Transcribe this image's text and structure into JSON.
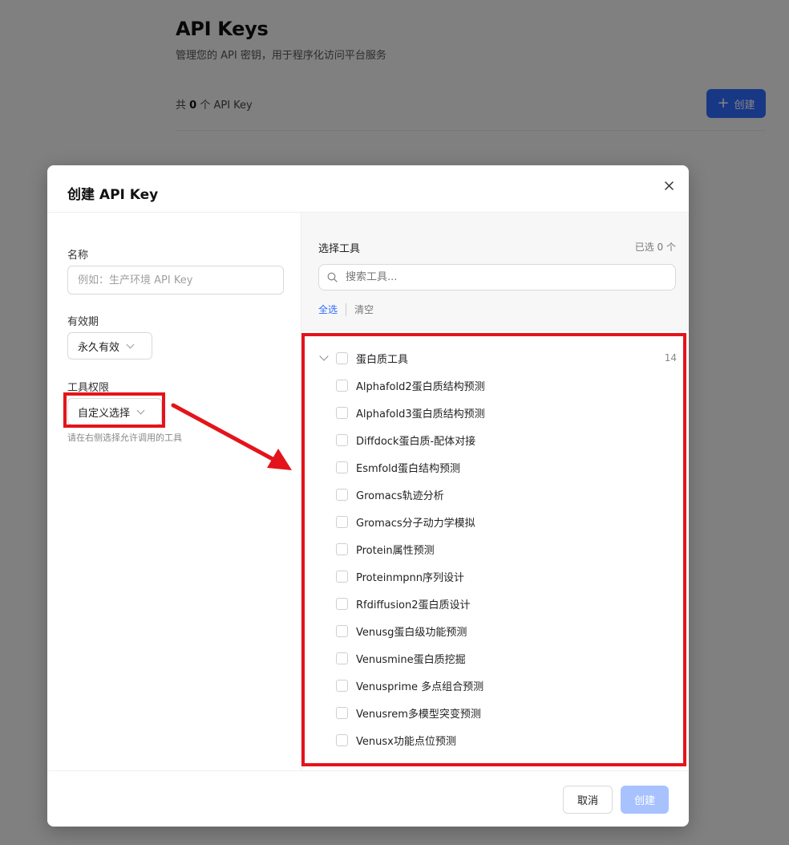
{
  "page": {
    "title": "API Keys",
    "subtitle": "管理您的 API 密钥，用于程序化访问平台服务",
    "count_prefix": "共",
    "count_value": "0",
    "count_suffix": "个 API Key",
    "create_label": "创建"
  },
  "modal": {
    "title": "创建 API Key",
    "close_icon": "close-icon",
    "name_label": "名称",
    "name_placeholder": "例如：生产环境 API Key",
    "name_value": "",
    "expiry_label": "有效期",
    "expiry_value": "永久有效",
    "permission_label": "工具权限",
    "permission_value": "自定义选择",
    "permission_hint": "请在右侧选择允许调用的工具",
    "tools_title": "选择工具",
    "selected_count": "已选 0 个",
    "search_placeholder": "搜索工具...",
    "select_all": "全选",
    "clear": "清空",
    "group": {
      "name": "蛋白质工具",
      "count": "14"
    },
    "tools": [
      "Alphafold2蛋白质结构预测",
      "Alphafold3蛋白质结构预测",
      "Diffdock蛋白质-配体对接",
      "Esmfold蛋白结构预测",
      "Gromacs轨迹分析",
      "Gromacs分子动力学模拟",
      "Protein属性预测",
      "Proteinmpnn序列设计",
      "Rfdiffusion2蛋白质设计",
      "Venusg蛋白级功能预测",
      "Venusmine蛋白质挖掘",
      "Venusprime 多点组合预测",
      "Venusrem多模型突变预测",
      "Venusx功能点位预测"
    ],
    "cancel_label": "取消",
    "create_label": "创建"
  },
  "colors": {
    "accent": "#2f6bff",
    "disabled_accent": "#a8c1ff",
    "annotation_red": "#e4141b"
  }
}
